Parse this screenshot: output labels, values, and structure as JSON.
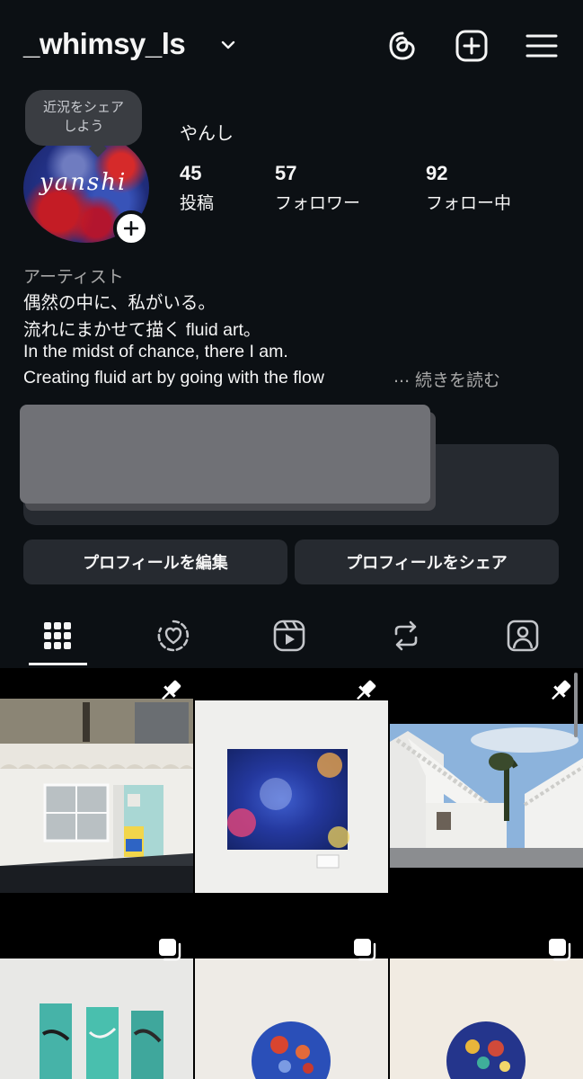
{
  "header": {
    "username": "_whimsy_ls",
    "chevron_icon": "chevron-down-icon",
    "icons": [
      "threads-icon",
      "create-post-icon",
      "menu-icon"
    ]
  },
  "profile": {
    "avatar_text": "yanshi",
    "note_bubble": {
      "line1": "近況をシェア",
      "line2": "しよう"
    },
    "display_name": "やんし",
    "stats": {
      "posts": {
        "count": "45",
        "label": "投稿"
      },
      "followers": {
        "count": "57",
        "label": "フォロワー"
      },
      "following": {
        "count": "92",
        "label": "フォロー中"
      }
    },
    "category": "アーティスト",
    "bio": [
      "偶然の中に、私がいる。",
      "流れにまかせて描く fluid art。",
      "In the midst of chance, there I am.",
      "Creating fluid art by going with the flow"
    ],
    "ellipsis": "...",
    "read_more": "続きを読む"
  },
  "buttons": {
    "edit_profile": "プロフィールを編集",
    "share_profile": "プロフィールをシェア"
  },
  "tabs": [
    {
      "name": "grid-icon",
      "active": true
    },
    {
      "name": "liked-icon",
      "active": false
    },
    {
      "name": "reels-icon",
      "active": false
    },
    {
      "name": "reposts-icon",
      "active": false
    },
    {
      "name": "tagged-icon",
      "active": false
    }
  ],
  "colors": {
    "background": "#0c1014",
    "surface": "#262a30",
    "text": "#f5f5f5",
    "muted": "#a8a8a8",
    "redaction": "#707176"
  }
}
